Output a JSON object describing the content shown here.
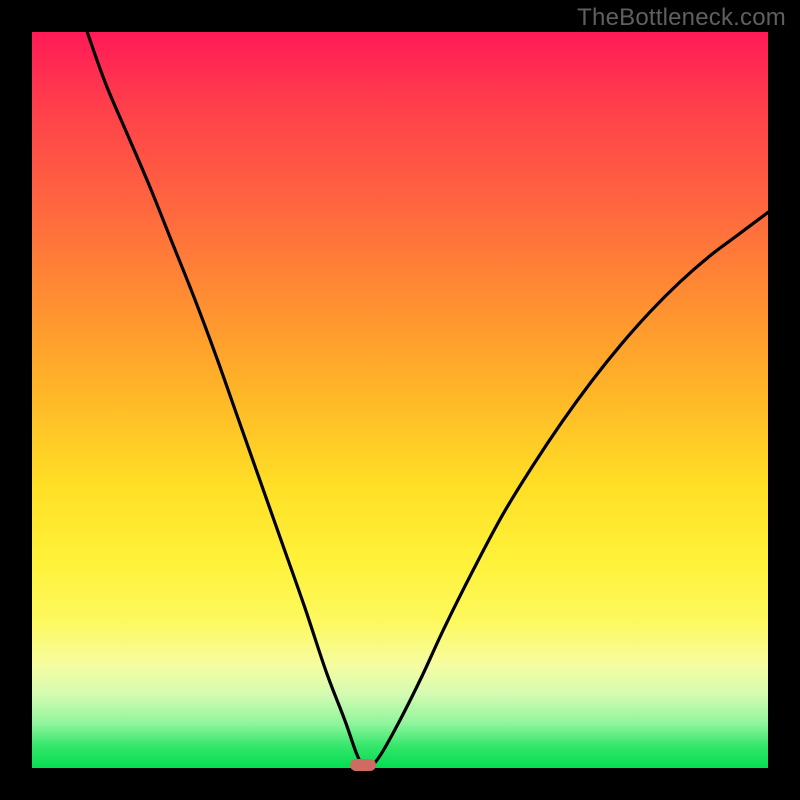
{
  "watermark": "TheBottleneck.com",
  "colors": {
    "frame_bg": "#000000",
    "curve_stroke": "#000000",
    "marker_fill": "#cf6b63",
    "gradient_stops": [
      "#ff1a57",
      "#ff3f4b",
      "#ff6a3e",
      "#ff9330",
      "#ffb927",
      "#ffe026",
      "#fff23a",
      "#fdf95e",
      "#f6fca0",
      "#d4fbb2",
      "#8ff59c",
      "#35e66b",
      "#04dd52"
    ]
  },
  "chart_data": {
    "type": "line",
    "title": "",
    "xlabel": "",
    "ylabel": "",
    "xlim": [
      0,
      1
    ],
    "ylim": [
      0,
      1
    ],
    "notes": "Axis ticks and labels absent; values are normalized 0–1 estimates from pixels. Two monotone branches meet at a minimum near x≈0.45, y≈0. Small rounded marker sits at the minimum.",
    "series": [
      {
        "name": "left-branch",
        "x": [
          0.075,
          0.1,
          0.13,
          0.16,
          0.19,
          0.22,
          0.25,
          0.28,
          0.31,
          0.34,
          0.37,
          0.4,
          0.425,
          0.44,
          0.45
        ],
        "values": [
          1.0,
          0.93,
          0.86,
          0.79,
          0.715,
          0.64,
          0.56,
          0.475,
          0.39,
          0.305,
          0.22,
          0.13,
          0.065,
          0.022,
          0.0
        ]
      },
      {
        "name": "right-branch",
        "x": [
          0.46,
          0.475,
          0.5,
          0.53,
          0.56,
          0.6,
          0.64,
          0.68,
          0.72,
          0.76,
          0.8,
          0.84,
          0.88,
          0.92,
          0.96,
          1.0
        ],
        "values": [
          0.0,
          0.02,
          0.065,
          0.125,
          0.19,
          0.27,
          0.345,
          0.41,
          0.47,
          0.525,
          0.575,
          0.62,
          0.66,
          0.695,
          0.725,
          0.755
        ]
      }
    ],
    "marker": {
      "x": 0.45,
      "y": 0.0
    }
  }
}
